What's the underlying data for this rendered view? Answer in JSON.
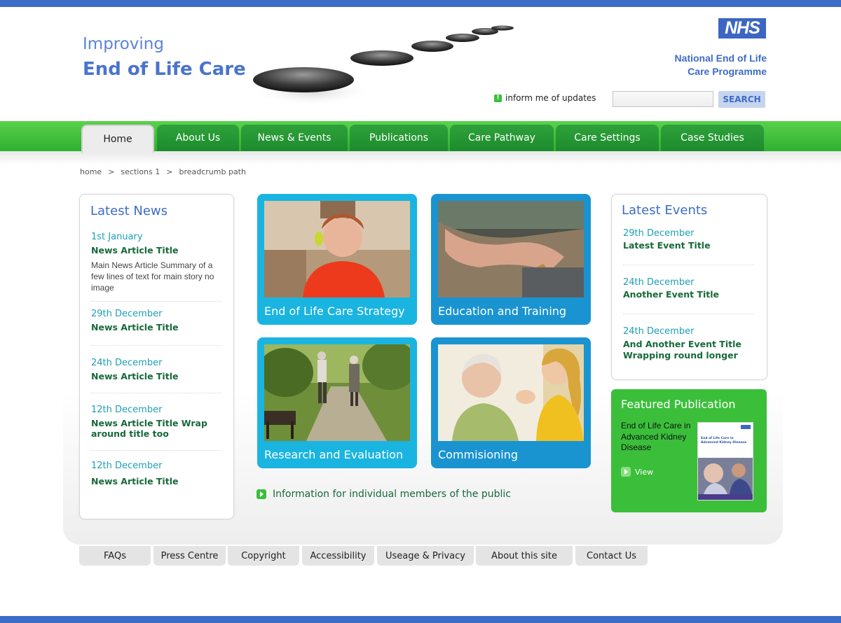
{
  "header": {
    "title_line1": "Improving",
    "title_line2": "End of Life Care",
    "logo_text": "NHS",
    "programme_line1": "National End of Life",
    "programme_line2": "Care Programme",
    "updates_label": "inform me of updates",
    "search_placeholder": "",
    "search_button": "SEARCH"
  },
  "nav": {
    "tabs": [
      {
        "label": "Home",
        "active": true
      },
      {
        "label": "About Us"
      },
      {
        "label": "News & Events"
      },
      {
        "label": "Publications"
      },
      {
        "label": "Care Pathway"
      },
      {
        "label": "Care Settings"
      },
      {
        "label": "Case Studies"
      }
    ]
  },
  "breadcrumb": {
    "items": [
      "home",
      "sections 1",
      "breadcrumb path"
    ],
    "separator": ">"
  },
  "latest_news": {
    "title": "Latest News",
    "items": [
      {
        "date": "1st January",
        "title": "News Article Title",
        "summary": "Main News Article Summary of a few lines of text for main story no image"
      },
      {
        "date": "29th December",
        "title": "News Article Title"
      },
      {
        "date": "24th December",
        "title": "News Article Title"
      },
      {
        "date": "12th December",
        "title": "News Article Title Wrap around title too"
      },
      {
        "date": "12th December",
        "title": "News Article Title"
      }
    ]
  },
  "cards": [
    {
      "caption": "End of Life Care Strategy"
    },
    {
      "caption": "Education and Training"
    },
    {
      "caption": "Research and Evaluation"
    },
    {
      "caption": "Commisioning"
    }
  ],
  "public_link": "Information for individual members of the public",
  "latest_events": {
    "title": "Latest Events",
    "items": [
      {
        "date": "29th December",
        "title": "Latest Event Title"
      },
      {
        "date": "24th December",
        "title": "Another Event Title"
      },
      {
        "date": "24th December",
        "title": "And Another Event Title Wrapping round longer"
      }
    ]
  },
  "featured": {
    "title": "Featured Publication",
    "description": "End of Life Care in Advanced Kidney Disease",
    "view_label": "View",
    "cover_text": "End of Life Care in Advanced Kidney Disease"
  },
  "footer": {
    "links": [
      "FAQs",
      "Press Centre",
      "Copyright",
      "Accessibility",
      "Useage & Privacy",
      "About this site",
      "Contact Us"
    ]
  },
  "colors": {
    "brand_blue": "#3d6bc8",
    "nav_green": "#2fb030",
    "card_cyan": "#1ab4e0",
    "card_blue": "#1a94d0",
    "featured_green": "#3bbf3b",
    "link_green": "#17693a"
  }
}
